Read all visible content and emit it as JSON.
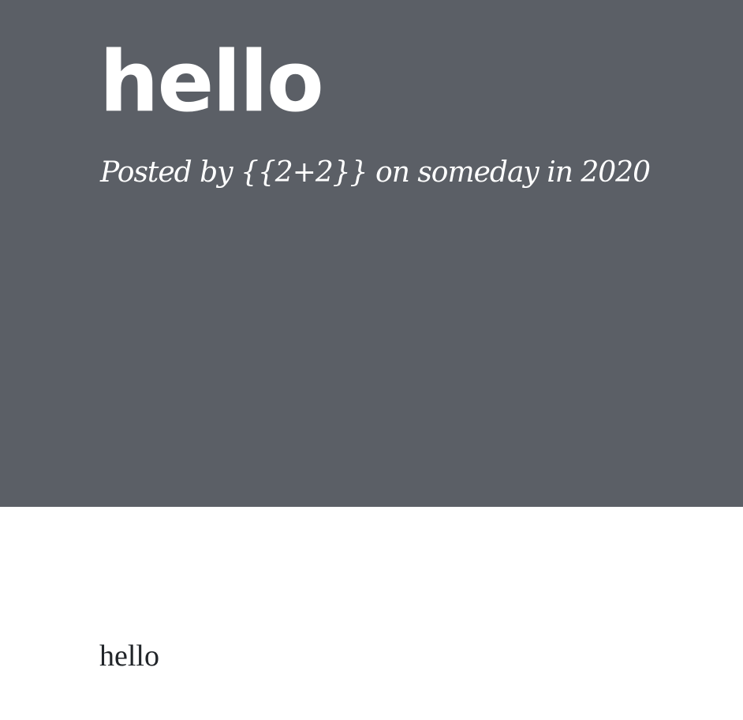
{
  "header": {
    "title": "hello",
    "meta": "Posted by {{2+2}} on someday in 2020"
  },
  "article": {
    "body": "hello"
  },
  "colors": {
    "header_background": "#5b5f66",
    "header_text": "#ffffff",
    "body_text": "#212529",
    "page_background": "#ffffff"
  }
}
